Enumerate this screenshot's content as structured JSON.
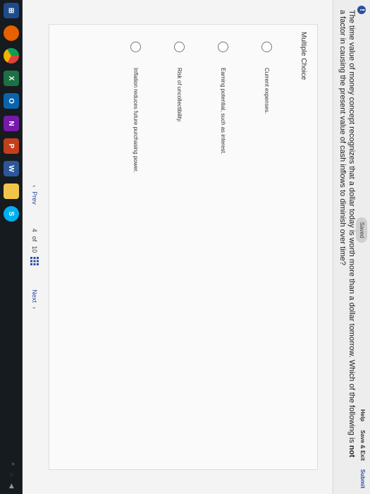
{
  "topbar": {
    "saved": "Saved",
    "help": "Help",
    "save_exit": "Save & Exit",
    "submit": "Submit"
  },
  "question": {
    "part1": "The time value of money concept recognizes that a dollar today is worth more than a dollar tomorrow. Which of the following is ",
    "bold": "not",
    "part2": " a factor in causing the present value of cash inflows to diminish over time?"
  },
  "main": {
    "multiple_choice_label": "Multiple Choice",
    "options": [
      {
        "label": "Current expenses."
      },
      {
        "label": "Earning potential, such as interest."
      },
      {
        "label": "Risk of uncollectibility."
      },
      {
        "label": "Inflation reduces future purchasing power."
      }
    ]
  },
  "pager": {
    "prev_label": "Prev",
    "current_page": "4",
    "of_text": "of",
    "total_pages": "10",
    "next_label": "Next"
  },
  "taskbar": {
    "icons": [
      "start-icon",
      "firefox-icon",
      "chrome-icon",
      "excel-icon",
      "outlook-icon",
      "onenote-icon",
      "powerpoint-icon",
      "word-icon",
      "explorer-icon",
      "skype-icon"
    ]
  }
}
